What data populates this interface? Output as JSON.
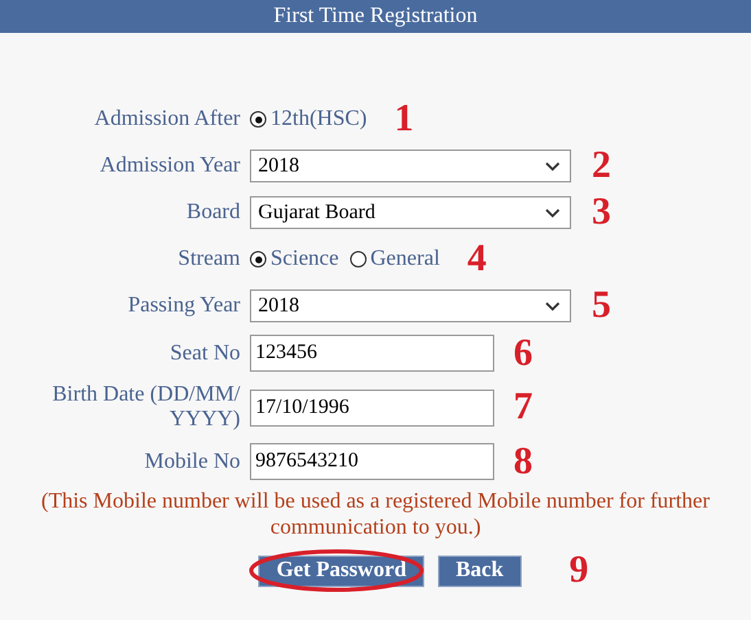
{
  "header": {
    "title": "First Time Registration"
  },
  "fields": [
    {
      "kind": "radio",
      "label": "Admission After",
      "options": [
        {
          "label": "12th(HSC)",
          "selected": true
        }
      ],
      "marker": "1"
    },
    {
      "kind": "select",
      "label": "Admission Year",
      "value": "2018",
      "marker": "2"
    },
    {
      "kind": "select",
      "label": "Board",
      "value": "Gujarat Board",
      "marker": "3"
    },
    {
      "kind": "radio",
      "label": "Stream",
      "options": [
        {
          "label": "Science",
          "selected": true
        },
        {
          "label": "General",
          "selected": false
        }
      ],
      "marker": "4"
    },
    {
      "kind": "select",
      "label": "Passing Year",
      "value": "2018",
      "marker": "5"
    },
    {
      "kind": "text",
      "label": "Seat No",
      "value": "123456",
      "marker": "6"
    },
    {
      "kind": "text",
      "label": "Birth Date (DD/MM/YYYY)",
      "value": "17/10/1996",
      "marker": "7"
    },
    {
      "kind": "text",
      "label": "Mobile No",
      "value": "9876543210",
      "marker": "8"
    }
  ],
  "note": "(This Mobile number will be used as a registered Mobile number for further communication to you.)",
  "buttons": [
    {
      "label": "Get Password",
      "circled": true
    },
    {
      "label": "Back",
      "circled": false
    }
  ],
  "buttons_marker": "9"
}
